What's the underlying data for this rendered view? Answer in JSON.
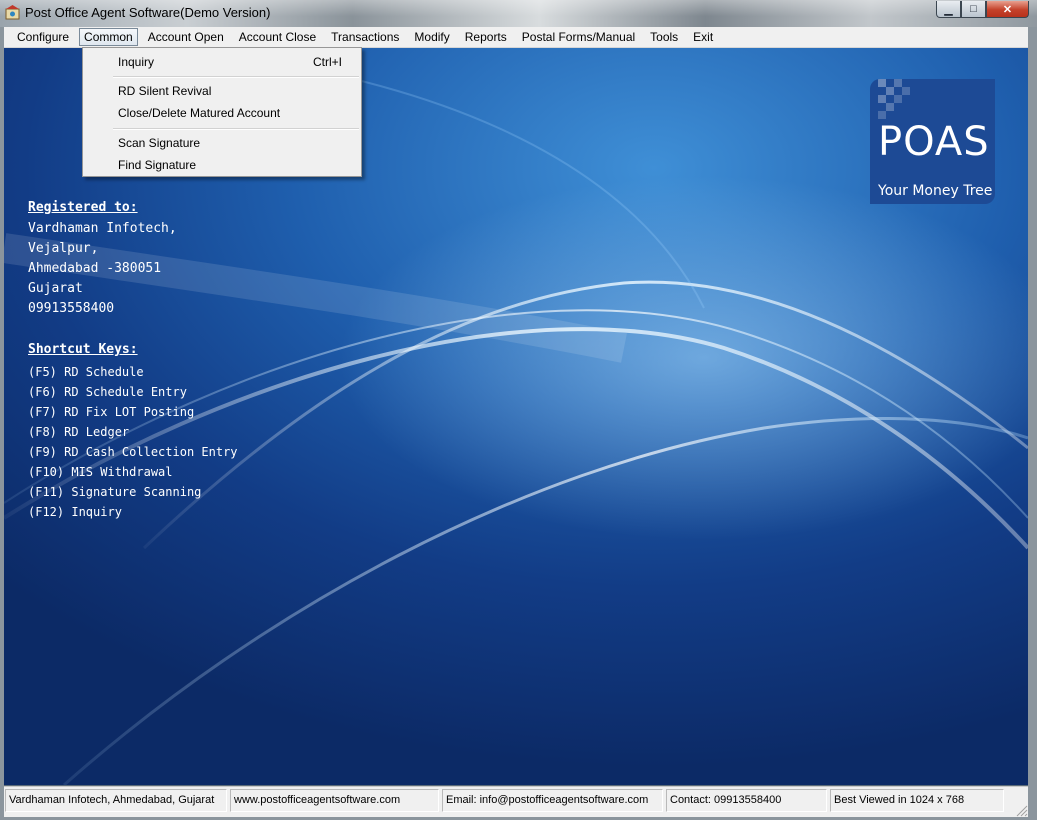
{
  "window": {
    "title": "Post Office Agent Software(Demo Version)",
    "controls": {
      "minimize": "▁",
      "maximize": "□",
      "close": "✕"
    }
  },
  "menubar": {
    "items": [
      "Configure",
      "Common",
      "Account Open",
      "Account Close",
      "Transactions",
      "Modify",
      "Reports",
      "Postal Forms/Manual",
      "Tools",
      "Exit"
    ],
    "active": "Common"
  },
  "dropdown": {
    "inquiry": {
      "label": "Inquiry",
      "shortcut": "Ctrl+I"
    },
    "rd_silent_revival": "RD Silent Revival",
    "close_delete_matured": "Close/Delete Matured Account",
    "scan_signature": "Scan Signature",
    "find_signature": "Find Signature"
  },
  "logo": {
    "title": "POAS",
    "tagline": "Your Money Tree",
    "color": "#1d4a95"
  },
  "registered": {
    "heading": "Registered to:",
    "lines": [
      "Vardhaman Infotech,",
      "Vejalpur,",
      "Ahmedabad -380051",
      "Gujarat",
      "09913558400"
    ]
  },
  "shortcuts": {
    "heading": "Shortcut Keys:",
    "items": [
      "(F5) RD Schedule",
      "(F6) RD Schedule Entry",
      "(F7) RD Fix LOT Posting",
      "(F8) RD Ledger",
      "(F9) RD Cash Collection Entry",
      "(F10) MIS Withdrawal",
      "(F11) Signature Scanning",
      "(F12) Inquiry"
    ]
  },
  "statusbar": {
    "company": "Vardhaman Infotech, Ahmedabad, Gujarat",
    "website": "www.postofficeagentsoftware.com",
    "email": "Email: info@postofficeagentsoftware.com",
    "contact": "Contact: 09913558400",
    "best_viewed": "Best Viewed in 1024 x 768"
  }
}
